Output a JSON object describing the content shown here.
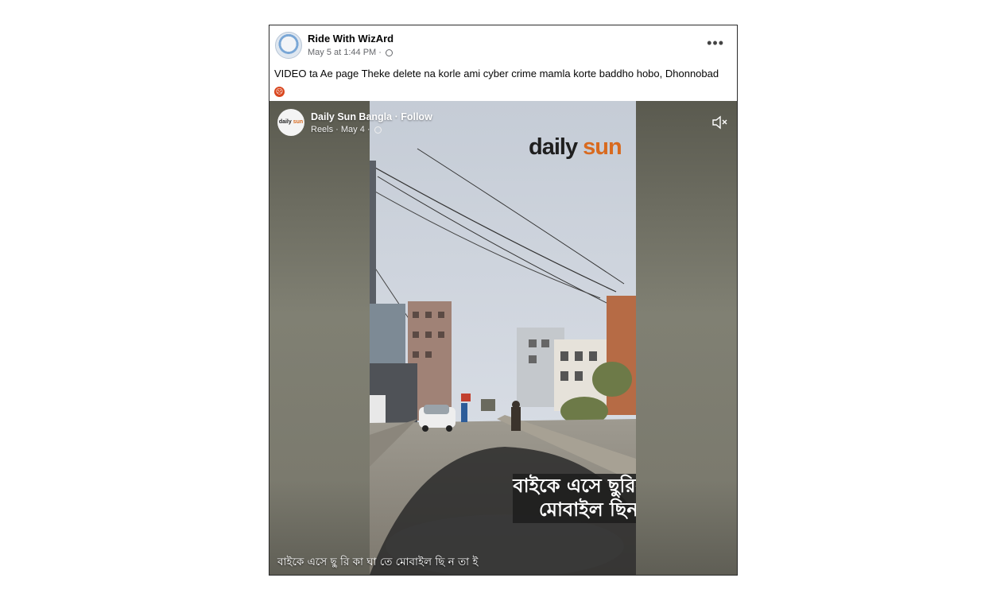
{
  "post": {
    "author": "Ride With WizArd",
    "timestamp": "May 5 at 1:44 PM",
    "privacy_icon": "globe-icon",
    "more_icon": "•••",
    "caption": "VIDEO ta Ae page Theke delete na korle ami cyber crime mamla korte baddho hobo, Dhonnobad",
    "caption_emoji": "angry-face-emoji"
  },
  "shared": {
    "page_name": "Daily Sun Bangla · Follow",
    "meta": "Reels · May 4 ·",
    "logo_text_daily": "daily",
    "logo_text_sun": "sun",
    "mute_icon": "speaker-muted-icon"
  },
  "video": {
    "brand_daily": "daily ",
    "brand_sun": "sun",
    "overlay_line1": "বাইকে এসে ছুরিকাঘাতে",
    "overlay_line2": "মোবাইল ছিনতাই",
    "bottom_caption": "বাইকে এসে ছু রি কা ঘা তে মোবাইল ছি ন তা ই"
  },
  "colors": {
    "brand_orange": "#d86a1f",
    "author_text": "#050505",
    "meta_text": "#65676b"
  }
}
